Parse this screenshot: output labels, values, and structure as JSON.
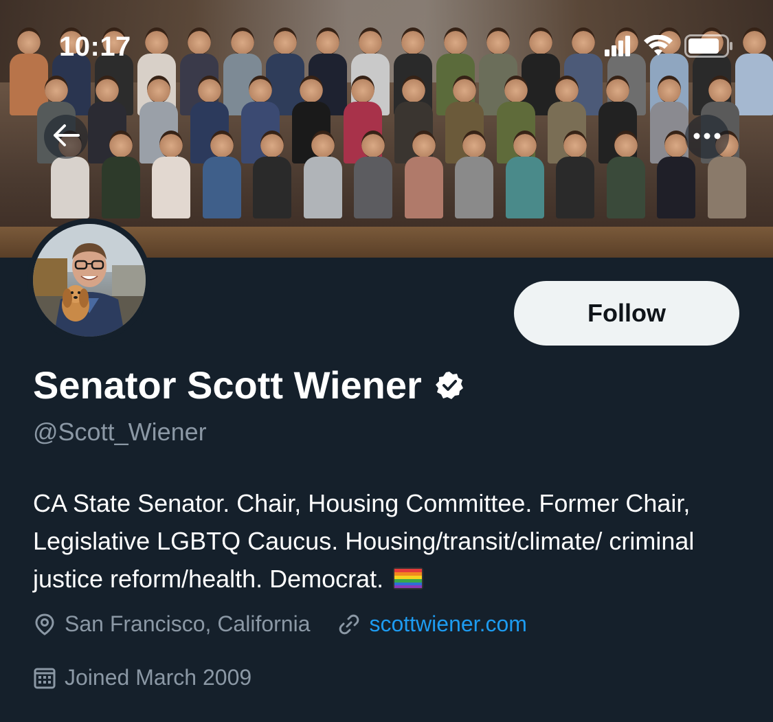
{
  "status_bar": {
    "time": "10:17"
  },
  "banner": {
    "alt": "Group photo"
  },
  "profile": {
    "display_name": "Senator Scott Wiener",
    "handle": "@Scott_Wiener",
    "bio": "CA State Senator. Chair, Housing Committee. Former Chair, Legislative LGBTQ Caucus. Housing/transit/climate/ criminal justice reform/health. Democrat.",
    "location": "San Francisco, California",
    "website": "scottwiener.com",
    "joined": "Joined March 2009"
  },
  "actions": {
    "follow_label": "Follow"
  },
  "icons": {
    "back": "back-arrow-icon",
    "more": "more-options-icon",
    "verified": "verified-badge-icon",
    "location": "location-pin-icon",
    "link": "link-icon",
    "calendar": "calendar-icon"
  },
  "colors": {
    "background": "#15202b",
    "accent_link": "#1d9bf0",
    "secondary_text": "#8b98a5",
    "follow_button_bg": "#eff3f4"
  }
}
